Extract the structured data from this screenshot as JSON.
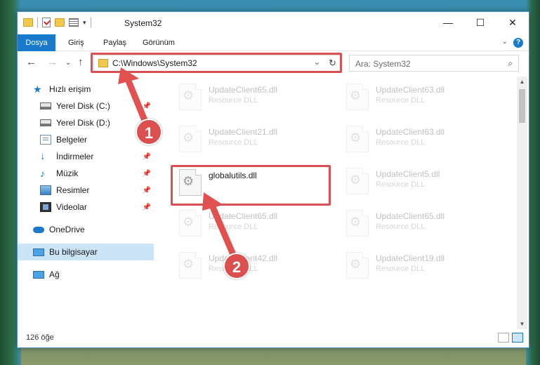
{
  "window": {
    "title": "System32",
    "controls": {
      "minimize": "—",
      "maximize": "☐",
      "close": "✕"
    }
  },
  "ribbon": {
    "tabs": [
      "Dosya",
      "Giriş",
      "Paylaş",
      "Görünüm"
    ],
    "help": "?"
  },
  "nav": {
    "path": "C:\\Windows\\System32",
    "search_placeholder": "Ara: System32"
  },
  "sidebar": {
    "quick_access": "Hızlı erişim",
    "items": [
      {
        "label": "Yerel Disk (C:)",
        "icon": "disk-icon",
        "pinned": true
      },
      {
        "label": "Yerel Disk (D:)",
        "icon": "disk-icon",
        "pinned": false
      },
      {
        "label": "Belgeler",
        "icon": "documents-icon",
        "pinned": true
      },
      {
        "label": "İndirmeler",
        "icon": "downloads-icon",
        "pinned": true
      },
      {
        "label": "Müzik",
        "icon": "music-icon",
        "pinned": true
      },
      {
        "label": "Resimler",
        "icon": "pictures-icon",
        "pinned": true
      },
      {
        "label": "Videolar",
        "icon": "videos-icon",
        "pinned": true
      }
    ],
    "onedrive": "OneDrive",
    "this_pc": "Bu bilgisayar",
    "network": "Ağ"
  },
  "files": [
    {
      "name": "UpdateClient65.dll",
      "type": "Resource DLL"
    },
    {
      "name": "UpdateClient63.dll",
      "type": "Resource DLL"
    },
    {
      "name": "UpdateClient21.dll",
      "type": "Resource DLL"
    },
    {
      "name": "UpdateClient63.dll",
      "type": "Resource DLL"
    },
    {
      "name": "globalutils.dll",
      "type": ""
    },
    {
      "name": "UpdateClient5.dll",
      "type": "Resource DLL"
    },
    {
      "name": "UpdateClient65.dll",
      "type": "Resource DLL"
    },
    {
      "name": "UpdateClient65.dll",
      "type": "Resource DLL"
    },
    {
      "name": "UpdateClient42.dll",
      "type": "Resource DLL"
    },
    {
      "name": "UpdateClient19.dll",
      "type": "Resource DLL"
    }
  ],
  "status": {
    "count": "126 öğe"
  },
  "annotations": {
    "step1": "1",
    "step2": "2",
    "color": "#db4f4f"
  }
}
